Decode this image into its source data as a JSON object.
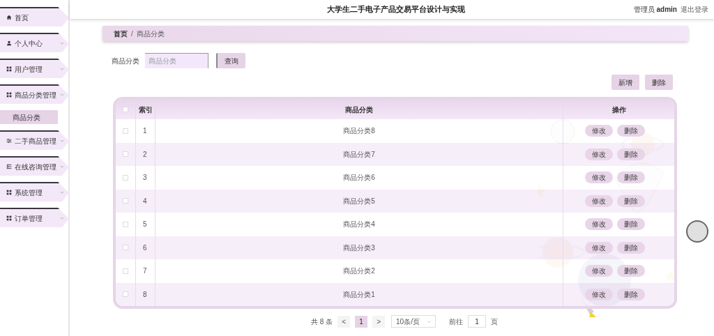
{
  "header": {
    "title": "大学生二手电子产品交易平台设计与实现",
    "user": "管理员 **admin**",
    "logout": "退出登录"
  },
  "sidebar": {
    "items": [
      {
        "label": "首页",
        "selected": false
      },
      {
        "label": "个人中心",
        "selected": false,
        "expanded": false
      },
      {
        "label": "用户管理",
        "selected": false,
        "expanded": false
      },
      {
        "label": "商品分类管理",
        "selected": false,
        "expanded": true,
        "children": [
          {
            "label": "商品分类",
            "selected": true
          }
        ]
      },
      {
        "label": "二手商品管理",
        "selected": false,
        "expanded": false
      },
      {
        "label": "在线咨询管理",
        "selected": false,
        "expanded": false
      },
      {
        "label": "系统管理",
        "selected": false,
        "expanded": false
      },
      {
        "label": "订单管理",
        "selected": false,
        "expanded": false
      }
    ]
  },
  "breadcrumb": {
    "items": [
      "首页",
      "商品分类"
    ],
    "separator": "/"
  },
  "search": {
    "label": "商品分类",
    "placeholder": "商品分类",
    "button": "查询"
  },
  "actions": [
    "新增",
    "删除"
  ],
  "table": {
    "header_checked": false,
    "columns": [
      "索引",
      "商品分类",
      "操作"
    ],
    "rows": [
      {
        "checked": false,
        "index": "1",
        "name": "商品分类8",
        "actions": [
          "修改",
          "删除"
        ]
      },
      {
        "checked": false,
        "index": "2",
        "name": "商品分类7",
        "actions": [
          "修改",
          "删除"
        ]
      },
      {
        "checked": false,
        "index": "3",
        "name": "商品分类6",
        "actions": [
          "修改",
          "删除"
        ]
      },
      {
        "checked": false,
        "index": "4",
        "name": "商品分类5",
        "actions": [
          "修改",
          "删除"
        ]
      },
      {
        "checked": false,
        "index": "5",
        "name": "商品分类4",
        "actions": [
          "修改",
          "删除"
        ]
      },
      {
        "checked": false,
        "index": "6",
        "name": "商品分类3",
        "actions": [
          "修改",
          "删除"
        ]
      },
      {
        "checked": false,
        "index": "7",
        "name": "商品分类2",
        "actions": [
          "修改",
          "删除"
        ]
      },
      {
        "checked": false,
        "index": "8",
        "name": "商品分类1",
        "actions": [
          "修改",
          "删除"
        ]
      }
    ]
  },
  "pagination": {
    "total": "共 8 条",
    "prev": "<",
    "pages": [
      {
        "label": "1",
        "selected": true
      }
    ],
    "next": ">",
    "page_size": "10条/页",
    "goto_label": "前往",
    "goto_value": "1",
    "goto_suffix": "页"
  }
}
